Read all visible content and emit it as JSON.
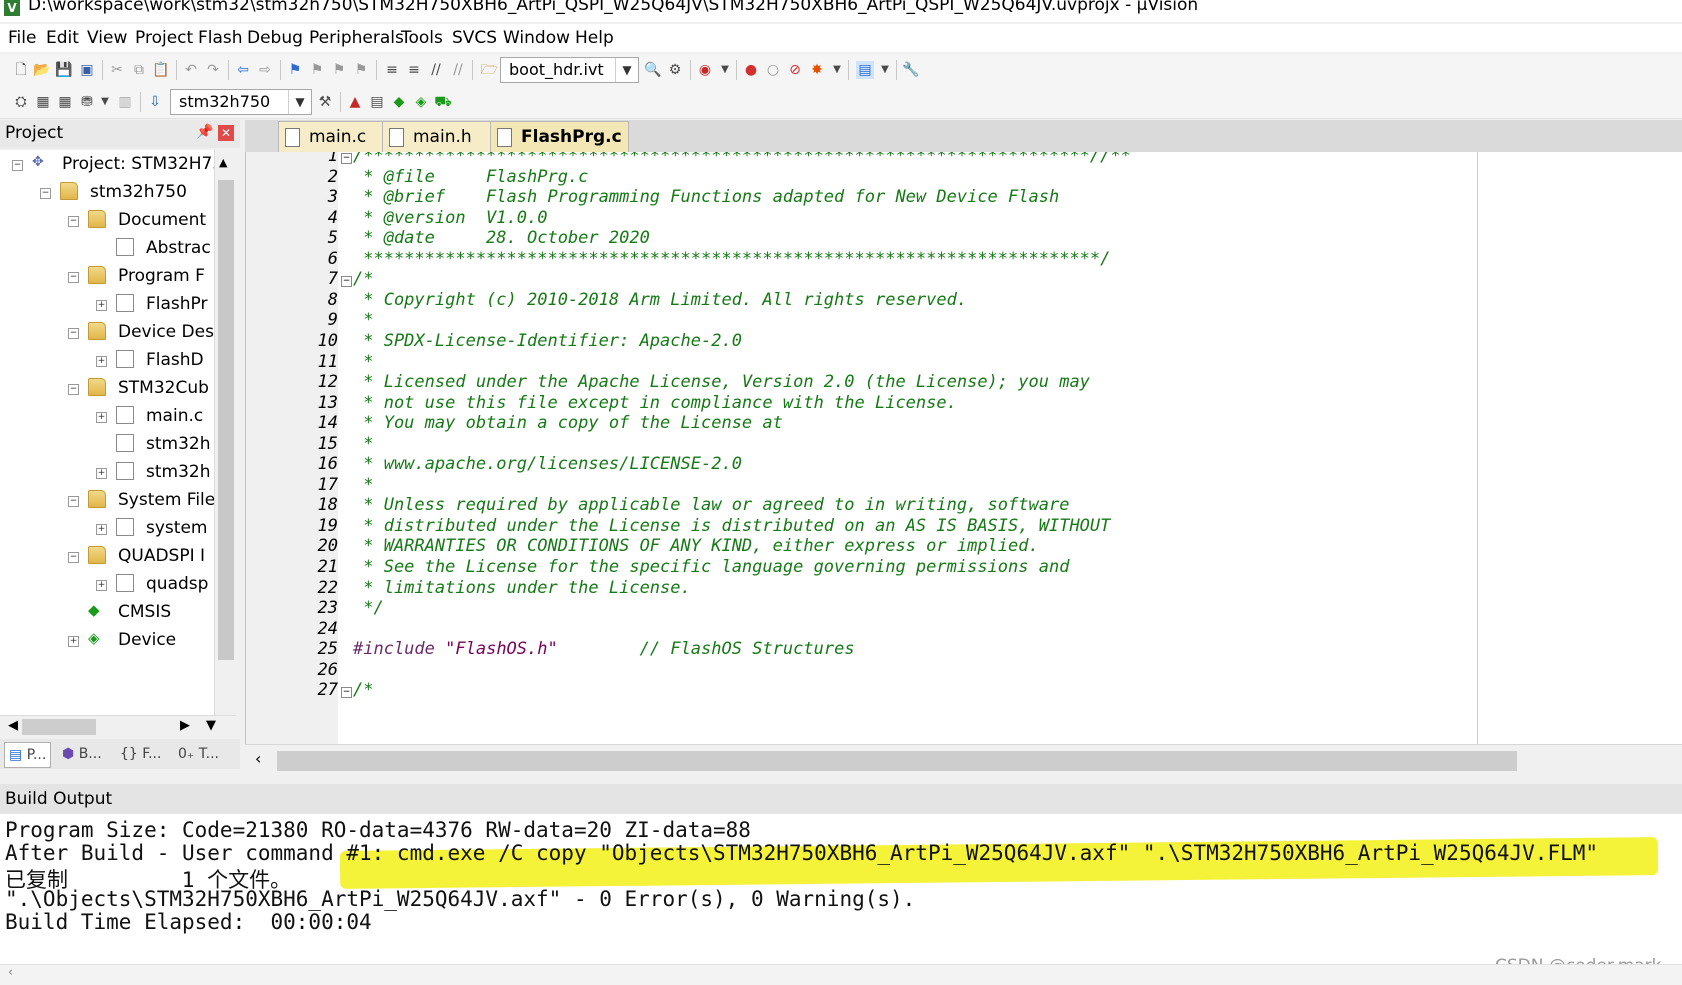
{
  "window": {
    "title": "D:\\workspace\\work\\stm32\\stm32h750\\STM32H750XBH6_ArtPi_QSPI_W25Q64JV\\STM32H750XBH6_ArtPi_QSPI_W25Q64JV.uvprojx - µVision"
  },
  "menu": [
    "File",
    "Edit",
    "View",
    "Project",
    "Flash",
    "Debug",
    "Peripherals",
    "Tools",
    "SVCS",
    "Window",
    "Help"
  ],
  "toolbar": {
    "file_combo": "boot_hdr.ivt",
    "target_combo": "stm32h750"
  },
  "project": {
    "title": "Project",
    "tree": [
      {
        "label": "Project: STM32H75"
      },
      {
        "label": "stm32h750"
      },
      {
        "label": "Document"
      },
      {
        "label": "Abstrac"
      },
      {
        "label": "Program F"
      },
      {
        "label": "FlashPr"
      },
      {
        "label": "Device Des"
      },
      {
        "label": "FlashD"
      },
      {
        "label": "STM32Cub"
      },
      {
        "label": "main.c"
      },
      {
        "label": "stm32h"
      },
      {
        "label": "stm32h"
      },
      {
        "label": "System File"
      },
      {
        "label": "system"
      },
      {
        "label": "QUADSPI I"
      },
      {
        "label": "quadsp"
      },
      {
        "label": "CMSIS"
      },
      {
        "label": "Device"
      }
    ],
    "bottom_tabs": [
      "P...",
      "B...",
      "F...",
      "T..."
    ]
  },
  "editor": {
    "tabs": [
      "main.c",
      "main.h",
      "FlashPrg.c"
    ],
    "active_tab": "FlashPrg.c",
    "lines": [
      "/***********************************************************************//**",
      " * @file     FlashPrg.c",
      " * @brief    Flash Programming Functions adapted for New Device Flash",
      " * @version  V1.0.0",
      " * @date     28. October 2020",
      " ************************************************************************/",
      "/*",
      " * Copyright (c) 2010-2018 Arm Limited. All rights reserved.",
      " *",
      " * SPDX-License-Identifier: Apache-2.0",
      " *",
      " * Licensed under the Apache License, Version 2.0 (the License); you may",
      " * not use this file except in compliance with the License.",
      " * You may obtain a copy of the License at",
      " *",
      " * www.apache.org/licenses/LICENSE-2.0",
      " *",
      " * Unless required by applicable law or agreed to in writing, software",
      " * distributed under the License is distributed on an AS IS BASIS, WITHOUT",
      " * WARRANTIES OR CONDITIONS OF ANY KIND, either express or implied.",
      " * See the License for the specific language governing permissions and",
      " * limitations under the License.",
      " */",
      "",
      "",
      "",
      "/*"
    ],
    "include": {
      "directive": "#include",
      "file": "\"FlashOS.h\"",
      "comment": "// FlashOS Structures"
    },
    "line_numbers": [
      "1",
      "2",
      "3",
      "4",
      "5",
      "6",
      "7",
      "8",
      "9",
      "10",
      "11",
      "12",
      "13",
      "14",
      "15",
      "16",
      "17",
      "18",
      "19",
      "20",
      "21",
      "22",
      "23",
      "24",
      "25",
      "26",
      "27"
    ]
  },
  "build_output": {
    "title": "Build Output",
    "lines": [
      "Program Size: Code=21380 RO-data=4376 RW-data=20 ZI-data=88",
      "After Build - User command #1: cmd.exe /C copy \"Objects\\STM32H750XBH6_ArtPi_W25Q64JV.axf\" \".\\STM32H750XBH6_ArtPi_W25Q64JV.FLM\"",
      "已复制         1 个文件。",
      "\".\\Objects\\STM32H750XBH6_ArtPi_W25Q64JV.axf\" - 0 Error(s), 0 Warning(s).",
      "Build Time Elapsed:  00:00:04"
    ],
    "watermark": "CSDN @coder.mark"
  },
  "colors": {
    "comment": "#157a15",
    "highlight": "#f5f23a",
    "accent": "#1f6fd1"
  }
}
